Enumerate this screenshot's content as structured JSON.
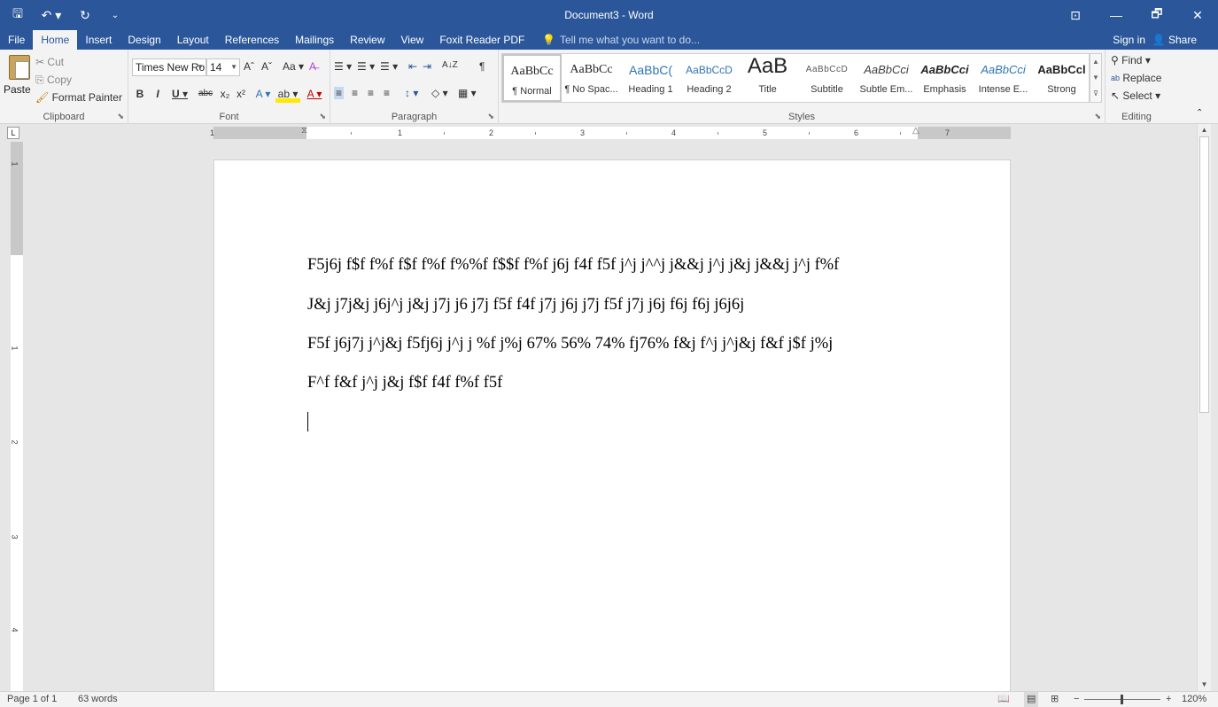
{
  "app": {
    "title": "Document3 - Word",
    "qat": {
      "save": "🖫",
      "undo": "↶ ▾",
      "redo": "↻",
      "customize": "⌄"
    },
    "window": {
      "restore_ribbon": "⊡",
      "minimize": "—",
      "restore": "🗗",
      "close": "✕"
    }
  },
  "tabs": [
    "File",
    "Home",
    "Insert",
    "Design",
    "Layout",
    "References",
    "Mailings",
    "Review",
    "View",
    "Foxit Reader PDF"
  ],
  "tell_me": "Tell me what you want to do...",
  "account": {
    "sign_in": "Sign in",
    "share": "Share"
  },
  "clipboard": {
    "label": "Clipboard",
    "paste": "Paste",
    "cut": "Cut",
    "copy": "Copy",
    "format_painter": "Format Painter"
  },
  "font": {
    "label": "Font",
    "font_name": "Times New Ro",
    "font_size": "14",
    "grow": "Aˆ",
    "shrink": "Aˇ",
    "change_case": "Aa ▾",
    "clear": "A̶",
    "bold": "B",
    "italic": "I",
    "underline": "U ▾",
    "strikethrough": "abc",
    "subscript": "x₂",
    "superscript": "x²",
    "text_effects": "A ▾",
    "highlight": "ab ▾",
    "font_color": "A ▾"
  },
  "paragraph": {
    "label": "Paragraph",
    "bullets": "☰ ▾",
    "numbering": "☰ ▾",
    "multilevel": "☰ ▾",
    "decrease_indent": "⇤",
    "increase_indent": "⇥",
    "sort": "A↓Z",
    "show_marks": "¶",
    "align_left": "≡",
    "center": "≡",
    "align_right": "≡",
    "justify": "≡",
    "line_spacing": "↕ ▾",
    "shading": "◇ ▾",
    "borders": "▦ ▾"
  },
  "styles": {
    "label": "Styles",
    "items": [
      {
        "sample": "AaBbCc",
        "name": "¶ Normal"
      },
      {
        "sample": "AaBbCc",
        "name": "¶ No Spac..."
      },
      {
        "sample": "AaBbC(",
        "name": "Heading 1"
      },
      {
        "sample": "AaBbCcD",
        "name": "Heading 2"
      },
      {
        "sample": "AaB",
        "name": "Title"
      },
      {
        "sample": "AaBbCcD",
        "name": "Subtitle"
      },
      {
        "sample": "AaBbCci",
        "name": "Subtle Em..."
      },
      {
        "sample": "AaBbCci",
        "name": "Emphasis"
      },
      {
        "sample": "AaBbCci",
        "name": "Intense E..."
      },
      {
        "sample": "AaBbCcl",
        "name": "Strong"
      }
    ]
  },
  "editing": {
    "label": "Editing",
    "find": "Find ▾",
    "replace": "Replace",
    "select": "Select ▾"
  },
  "ruler": {
    "tab_selector": "L",
    "h_numbers": [
      "1",
      "1",
      "2",
      "3",
      "4",
      "5",
      "6",
      "7"
    ],
    "v_numbers": [
      "1",
      "1",
      "2",
      "3",
      "4"
    ]
  },
  "document": {
    "paragraphs": [
      "F5j6j f$f f%f f$f f%f f%%f f$$f f%f j6j f4f f5f j^j j^^j j&&j j^j j&j j&&j j^j f%f",
      "J&j j7j&j j6j^j j&j j7j j6 j7j f5f f4f j7j j6j j7j f5f j7j j6j f6j f6j j6j6j",
      "F5f j6j7j j^j&j f5fj6j j^j j %f j%j 67% 56% 74% fj76% f&j f^j j^j&j f&f j$f j%j",
      "F^f f&f j^j j&j f$f f4f f%f f5f"
    ]
  },
  "status": {
    "page": "Page 1 of 1",
    "words": "63 words",
    "zoom": "120%",
    "zoom_minus": "−",
    "zoom_plus": "+"
  },
  "colors": {
    "accent": "#2b579a",
    "heading": "#2e74b5"
  }
}
